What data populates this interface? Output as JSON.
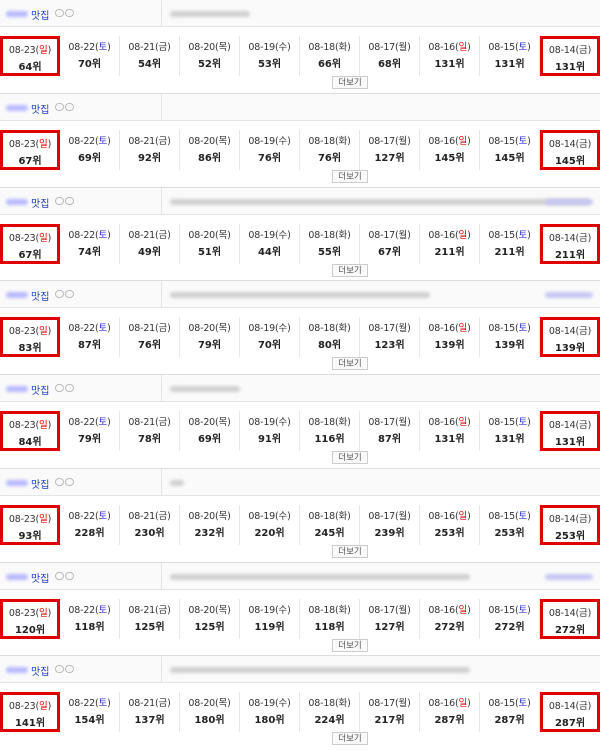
{
  "blocks": [
    {
      "title": "맛집",
      "more": "더보기",
      "dates": [
        "08-23",
        "08-22",
        "08-21",
        "08-20",
        "08-19",
        "08-18",
        "08-17",
        "08-16",
        "08-15",
        "08-14"
      ],
      "weekdays": [
        "일",
        "토",
        "금",
        "목",
        "수",
        "화",
        "월",
        "일",
        "토",
        "금"
      ],
      "ranks": [
        "64위",
        "70위",
        "54위",
        "52위",
        "53위",
        "66위",
        "68위",
        "131위",
        "131위",
        "131위"
      ]
    },
    {
      "title": "맛집",
      "more": "더보기",
      "dates": [
        "08-23",
        "08-22",
        "08-21",
        "08-20",
        "08-19",
        "08-18",
        "08-17",
        "08-16",
        "08-15",
        "08-14"
      ],
      "weekdays": [
        "일",
        "토",
        "금",
        "목",
        "수",
        "화",
        "월",
        "일",
        "토",
        "금"
      ],
      "ranks": [
        "67위",
        "69위",
        "92위",
        "86위",
        "76위",
        "76위",
        "127위",
        "145위",
        "145위",
        "145위"
      ]
    },
    {
      "title": "맛집",
      "more": "더보기",
      "dates": [
        "08-23",
        "08-22",
        "08-21",
        "08-20",
        "08-19",
        "08-18",
        "08-17",
        "08-16",
        "08-15",
        "08-14"
      ],
      "weekdays": [
        "일",
        "토",
        "금",
        "목",
        "수",
        "화",
        "월",
        "일",
        "토",
        "금"
      ],
      "ranks": [
        "67위",
        "74위",
        "49위",
        "51위",
        "44위",
        "55위",
        "67위",
        "211위",
        "211위",
        "211위"
      ]
    },
    {
      "title": "맛집",
      "more": "더보기",
      "dates": [
        "08-23",
        "08-22",
        "08-21",
        "08-20",
        "08-19",
        "08-18",
        "08-17",
        "08-16",
        "08-15",
        "08-14"
      ],
      "weekdays": [
        "일",
        "토",
        "금",
        "목",
        "수",
        "화",
        "월",
        "일",
        "토",
        "금"
      ],
      "ranks": [
        "83위",
        "87위",
        "76위",
        "79위",
        "70위",
        "80위",
        "123위",
        "139위",
        "139위",
        "139위"
      ]
    },
    {
      "title": "맛집",
      "more": "더보기",
      "dates": [
        "08-23",
        "08-22",
        "08-21",
        "08-20",
        "08-19",
        "08-18",
        "08-17",
        "08-16",
        "08-15",
        "08-14"
      ],
      "weekdays": [
        "일",
        "토",
        "금",
        "목",
        "수",
        "화",
        "월",
        "일",
        "토",
        "금"
      ],
      "ranks": [
        "84위",
        "79위",
        "78위",
        "69위",
        "91위",
        "116위",
        "87위",
        "131위",
        "131위",
        "131위"
      ]
    },
    {
      "title": "맛집",
      "more": "더보기",
      "dates": [
        "08-23",
        "08-22",
        "08-21",
        "08-20",
        "08-19",
        "08-18",
        "08-17",
        "08-16",
        "08-15",
        "08-14"
      ],
      "weekdays": [
        "일",
        "토",
        "금",
        "목",
        "수",
        "화",
        "월",
        "일",
        "토",
        "금"
      ],
      "ranks": [
        "93위",
        "228위",
        "230위",
        "232위",
        "220위",
        "245위",
        "239위",
        "253위",
        "253위",
        "253위"
      ]
    },
    {
      "title": "맛집",
      "more": "더보기",
      "dates": [
        "08-23",
        "08-22",
        "08-21",
        "08-20",
        "08-19",
        "08-18",
        "08-17",
        "08-16",
        "08-15",
        "08-14"
      ],
      "weekdays": [
        "일",
        "토",
        "금",
        "목",
        "수",
        "화",
        "월",
        "일",
        "토",
        "금"
      ],
      "ranks": [
        "120위",
        "118위",
        "125위",
        "125위",
        "119위",
        "118위",
        "127위",
        "272위",
        "272위",
        "272위"
      ]
    },
    {
      "title": "맛집",
      "more": "더보기",
      "dates": [
        "08-23",
        "08-22",
        "08-21",
        "08-20",
        "08-19",
        "08-18",
        "08-17",
        "08-16",
        "08-15",
        "08-14"
      ],
      "weekdays": [
        "일",
        "토",
        "금",
        "목",
        "수",
        "화",
        "월",
        "일",
        "토",
        "금"
      ],
      "ranks": [
        "141위",
        "154위",
        "137위",
        "180위",
        "180위",
        "224위",
        "217위",
        "287위",
        "287위",
        "287위"
      ]
    }
  ],
  "colors": {
    "highlight": "#e00000",
    "sunday": "#e00000",
    "saturday": "#2b2bd6",
    "title": "#1f3cc9"
  }
}
